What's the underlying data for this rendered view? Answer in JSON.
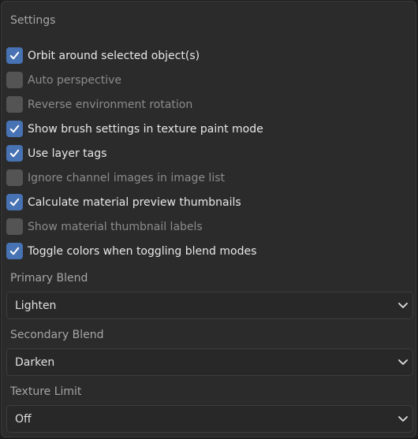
{
  "panel": {
    "title": "Settings"
  },
  "checkboxes": [
    {
      "label": "Orbit around selected object(s)",
      "checked": true
    },
    {
      "label": "Auto perspective",
      "checked": false
    },
    {
      "label": "Reverse environment rotation",
      "checked": false
    },
    {
      "label": "Show brush settings in texture paint mode",
      "checked": true
    },
    {
      "label": "Use layer tags",
      "checked": true
    },
    {
      "label": "Ignore channel images in image list",
      "checked": false
    },
    {
      "label": "Calculate material preview thumbnails",
      "checked": true
    },
    {
      "label": "Show material thumbnail labels",
      "checked": false
    },
    {
      "label": "Toggle colors when toggling blend modes",
      "checked": true
    }
  ],
  "primary_blend": {
    "label": "Primary Blend",
    "value": "Lighten"
  },
  "secondary_blend": {
    "label": "Secondary Blend",
    "value": "Darken"
  },
  "texture_limit": {
    "label": "Texture Limit",
    "value": "Off"
  },
  "colors": {
    "panel_bg": "#2b2b2b",
    "checkbox_on": "#4772b3",
    "checkbox_off": "#545454",
    "dropdown_bg": "#282828"
  },
  "icons": {
    "check": "checkmark-icon",
    "dropdown": "chevron-down-icon"
  }
}
